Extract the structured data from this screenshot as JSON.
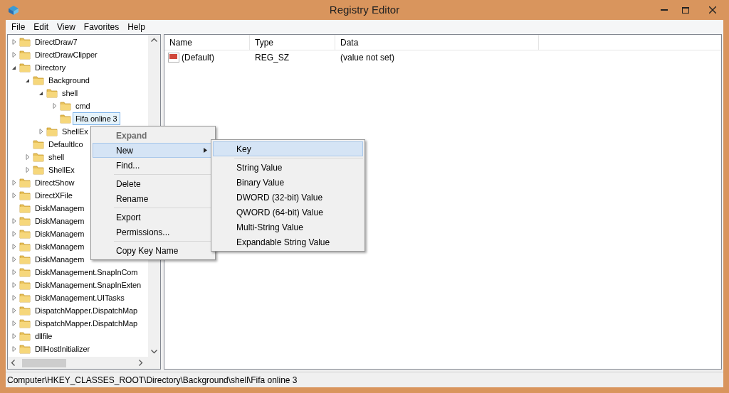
{
  "window": {
    "title": "Registry Editor"
  },
  "menu_bar": [
    "File",
    "Edit",
    "View",
    "Favorites",
    "Help"
  ],
  "tree": [
    {
      "label": "DirectDraw7",
      "kind": "node",
      "expanded": false,
      "selected": false
    },
    {
      "label": "DirectDrawClipper",
      "kind": "node",
      "expanded": false,
      "selected": false
    },
    {
      "label": "Directory",
      "kind": "node",
      "expanded": true,
      "selected": false,
      "children": [
        {
          "label": "Background",
          "kind": "node",
          "expanded": true,
          "selected": false,
          "children": [
            {
              "label": "shell",
              "kind": "node",
              "expanded": true,
              "selected": false,
              "children": [
                {
                  "label": "cmd",
                  "kind": "node",
                  "expanded": false,
                  "selected": false
                },
                {
                  "label": "Fifa online 3",
                  "kind": "leaf",
                  "selected": true
                }
              ]
            },
            {
              "label": "ShellEx",
              "kind": "node",
              "expanded": false,
              "selected": false
            }
          ]
        },
        {
          "label": "DefaultIco",
          "kind": "leaf",
          "selected": false
        },
        {
          "label": "shell",
          "kind": "node",
          "expanded": false,
          "selected": false
        },
        {
          "label": "ShellEx",
          "kind": "node",
          "expanded": false,
          "selected": false
        }
      ]
    },
    {
      "label": "DirectShow",
      "kind": "node",
      "expanded": false,
      "selected": false
    },
    {
      "label": "DirectXFile",
      "kind": "node",
      "expanded": false,
      "selected": false
    },
    {
      "label": "DiskManagem",
      "kind": "leaf",
      "selected": false
    },
    {
      "label": "DiskManagem",
      "kind": "node",
      "expanded": false,
      "selected": false
    },
    {
      "label": "DiskManagem",
      "kind": "node",
      "expanded": false,
      "selected": false
    },
    {
      "label": "DiskManagem",
      "kind": "node",
      "expanded": false,
      "selected": false
    },
    {
      "label": "DiskManagem",
      "kind": "node",
      "expanded": false,
      "selected": false
    },
    {
      "label": "DiskManagement.SnapInCom",
      "kind": "node",
      "expanded": false,
      "selected": false
    },
    {
      "label": "DiskManagement.SnapInExten",
      "kind": "node",
      "expanded": false,
      "selected": false
    },
    {
      "label": "DiskManagement.UITasks",
      "kind": "node",
      "expanded": false,
      "selected": false
    },
    {
      "label": "DispatchMapper.DispatchMap",
      "kind": "node",
      "expanded": false,
      "selected": false
    },
    {
      "label": "DispatchMapper.DispatchMap",
      "kind": "node",
      "expanded": false,
      "selected": false
    },
    {
      "label": "dllfile",
      "kind": "node",
      "expanded": false,
      "selected": false
    },
    {
      "label": "DllHostInitializer",
      "kind": "node",
      "expanded": false,
      "selected": false
    }
  ],
  "values": {
    "columns": [
      "Name",
      "Type",
      "Data"
    ],
    "rows": [
      {
        "name": "(Default)",
        "type": "REG_SZ",
        "data": "(value not set)"
      }
    ]
  },
  "context_menu": [
    {
      "kind": "item",
      "label": "Expand",
      "disabled": true,
      "selected": false,
      "submenu": false
    },
    {
      "kind": "item",
      "label": "New",
      "disabled": false,
      "selected": true,
      "submenu": true
    },
    {
      "kind": "item",
      "label": "Find...",
      "disabled": false,
      "selected": false,
      "submenu": false
    },
    {
      "kind": "separator"
    },
    {
      "kind": "item",
      "label": "Delete",
      "disabled": false,
      "selected": false,
      "submenu": false
    },
    {
      "kind": "item",
      "label": "Rename",
      "disabled": false,
      "selected": false,
      "submenu": false
    },
    {
      "kind": "separator"
    },
    {
      "kind": "item",
      "label": "Export",
      "disabled": false,
      "selected": false,
      "submenu": false
    },
    {
      "kind": "item",
      "label": "Permissions...",
      "disabled": false,
      "selected": false,
      "submenu": false
    },
    {
      "kind": "separator"
    },
    {
      "kind": "item",
      "label": "Copy Key Name",
      "disabled": false,
      "selected": false,
      "submenu": false
    }
  ],
  "submenu": [
    {
      "kind": "item",
      "label": "Key",
      "disabled": false,
      "selected": true,
      "submenu": false
    },
    {
      "kind": "separator"
    },
    {
      "kind": "item",
      "label": "String Value",
      "disabled": false,
      "selected": false,
      "submenu": false
    },
    {
      "kind": "item",
      "label": "Binary Value",
      "disabled": false,
      "selected": false,
      "submenu": false
    },
    {
      "kind": "item",
      "label": "DWORD (32-bit) Value",
      "disabled": false,
      "selected": false,
      "submenu": false
    },
    {
      "kind": "item",
      "label": "QWORD (64-bit) Value",
      "disabled": false,
      "selected": false,
      "submenu": false
    },
    {
      "kind": "item",
      "label": "Multi-String Value",
      "disabled": false,
      "selected": false,
      "submenu": false
    },
    {
      "kind": "item",
      "label": "Expandable String Value",
      "disabled": false,
      "selected": false,
      "submenu": false
    }
  ],
  "status_bar": "Computer\\HKEY_CLASSES_ROOT\\Directory\\Background\\shell\\Fifa online 3"
}
